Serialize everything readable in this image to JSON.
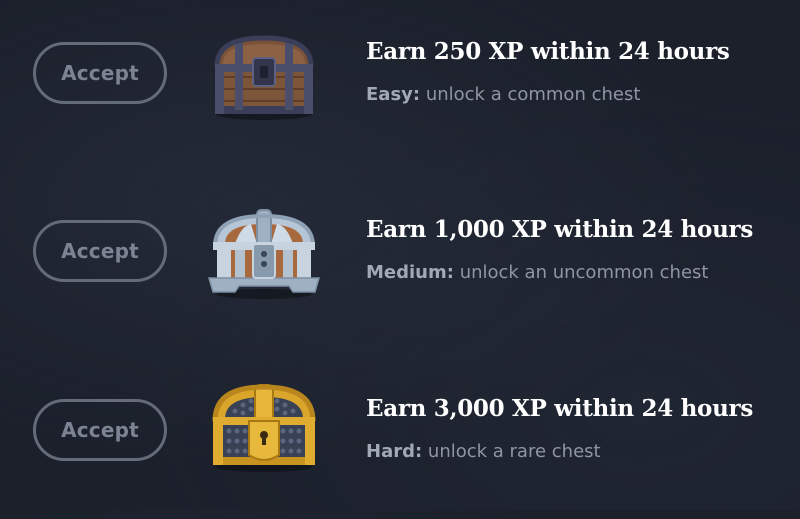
{
  "quests": [
    {
      "accept_label": "Accept",
      "title": "Earn 250 XP within 24 hours",
      "difficulty": "Easy:",
      "reward": "unlock a common chest",
      "chest_icon": "common-chest-icon"
    },
    {
      "accept_label": "Accept",
      "title": "Earn 1,000 XP within 24 hours",
      "difficulty": "Medium:",
      "reward": "unlock an uncommon chest",
      "chest_icon": "uncommon-chest-icon"
    },
    {
      "accept_label": "Accept",
      "title": "Earn 3,000 XP within 24 hours",
      "difficulty": "Hard:",
      "reward": "unlock a rare chest",
      "chest_icon": "rare-chest-icon"
    }
  ],
  "colors": {
    "background": "#1b202b",
    "button_border": "#646b79",
    "button_text": "#7c8493",
    "title": "#ffffff",
    "description": "#8f96a3"
  }
}
